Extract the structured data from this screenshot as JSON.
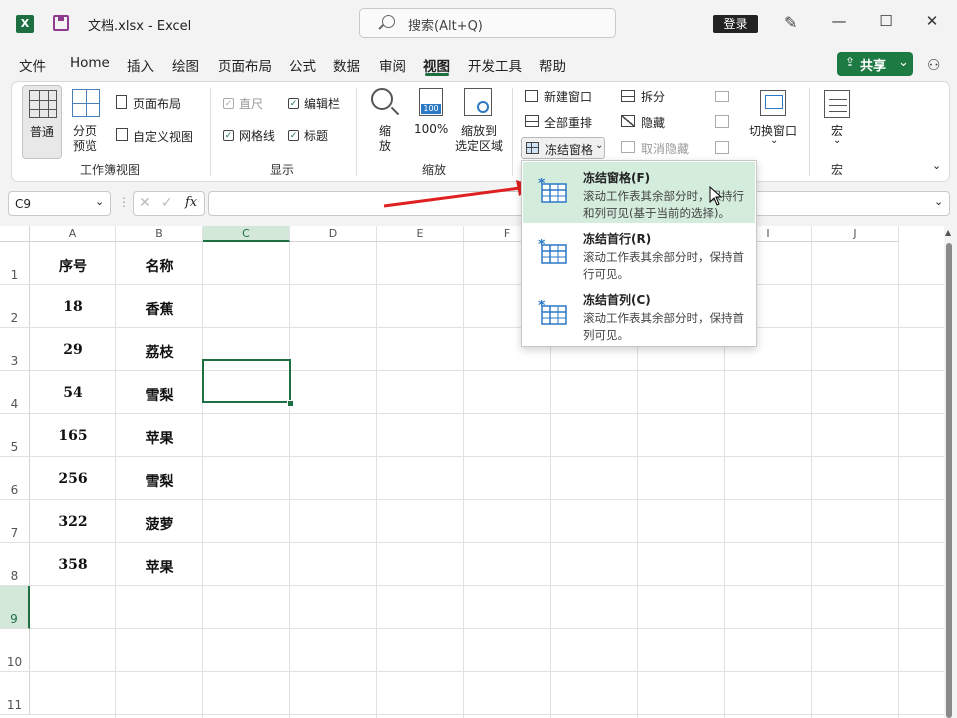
{
  "titlebar": {
    "doc_title": "文档.xlsx  -  Excel",
    "search_placeholder": "搜索(Alt+Q)",
    "login_label": "登录",
    "minimize": "—",
    "maximize": "☐",
    "close": "✕"
  },
  "menu": {
    "items": [
      "文件",
      "Home",
      "插入",
      "绘图",
      "页面布局",
      "公式",
      "数据",
      "审阅",
      "视图",
      "开发工具",
      "帮助"
    ],
    "active": "视图",
    "share_label": "共享"
  },
  "ribbon": {
    "workbook_views": {
      "normal": "普通",
      "page_break_1": "分页",
      "page_break_2": "预览",
      "page_layout": "页面布局",
      "custom_views": "自定义视图",
      "group_label": "工作簿视图"
    },
    "show": {
      "ruler": "直尺",
      "formula_bar": "编辑栏",
      "gridlines": "网格线",
      "headings": "标题",
      "group_label": "显示"
    },
    "zoom": {
      "zoom_1": "缩",
      "zoom_2": "放",
      "hundred": "100%",
      "hundred_icon_text": "100",
      "zoom_sel_1": "缩放到",
      "zoom_sel_2": "选定区域",
      "group_label": "缩放"
    },
    "window": {
      "new_window": "新建窗口",
      "arrange_all": "全部重排",
      "freeze_panes": "冻结窗格",
      "split": "拆分",
      "hide": "隐藏",
      "unhide": "取消隐藏",
      "switch_windows": "切换窗口"
    },
    "macros": {
      "macros": "宏",
      "group_label": "宏"
    }
  },
  "formula_bar": {
    "name_box": "C9",
    "fx": "fx",
    "value": ""
  },
  "sheet": {
    "columns": [
      "A",
      "B",
      "C",
      "D",
      "E",
      "F",
      "G",
      "H",
      "I",
      "J"
    ],
    "rows": [
      "1",
      "2",
      "3",
      "4",
      "5",
      "6",
      "7",
      "8",
      "9",
      "10",
      "11"
    ],
    "selected_column": "C",
    "selected_row": "9",
    "header": [
      "序号",
      "名称"
    ],
    "data": [
      [
        "18",
        "香蕉"
      ],
      [
        "29",
        "荔枝"
      ],
      [
        "54",
        "雪梨"
      ],
      [
        "165",
        "苹果"
      ],
      [
        "256",
        "雪梨"
      ],
      [
        "322",
        "菠萝"
      ],
      [
        "358",
        "苹果"
      ]
    ]
  },
  "dropdown": {
    "items": [
      {
        "title": "冻结窗格(F)",
        "desc": "滚动工作表其余部分时，保持行和列可见(基于当前的选择)。"
      },
      {
        "title": "冻结首行(R)",
        "desc": "滚动工作表其余部分时，保持首行可见。"
      },
      {
        "title": "冻结首列(C)",
        "desc": "滚动工作表其余部分时，保持首列可见。"
      }
    ]
  },
  "colors": {
    "accent": "#1d6f42",
    "highlight": "#d3ecdb",
    "arrow": "#e02020"
  }
}
